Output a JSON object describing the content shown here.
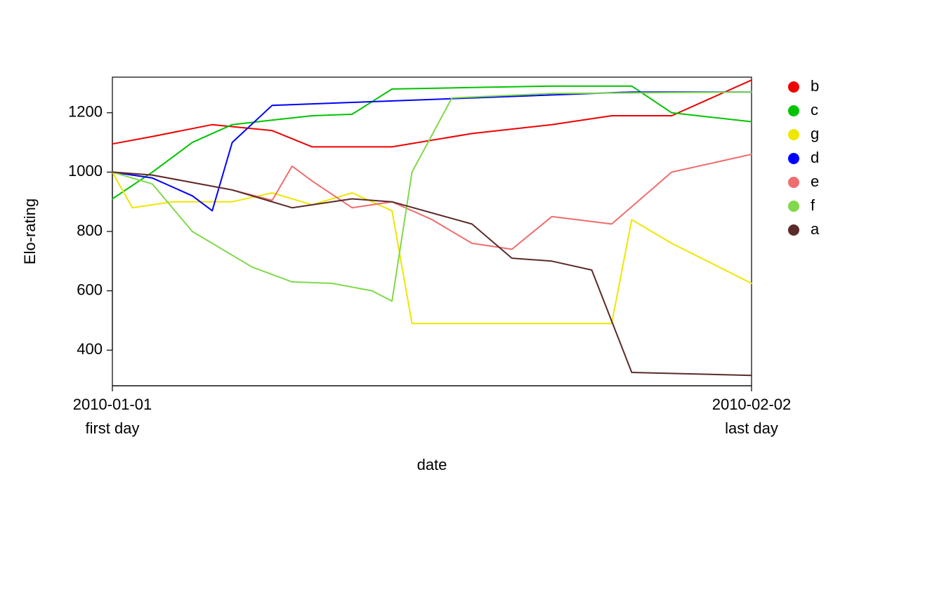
{
  "chart_data": {
    "type": "line",
    "xlabel": "date",
    "ylabel": "Elo-rating",
    "title": "",
    "xlim": [
      0,
      32
    ],
    "ylim": [
      280,
      1320
    ],
    "y_ticks": [
      400,
      600,
      800,
      1000,
      1200
    ],
    "x_tick_labels": [
      "2010-01-01",
      "2010-02-02"
    ],
    "x_tick_positions": [
      0,
      32
    ],
    "x_annotations": [
      "first day",
      "last day"
    ],
    "legend": [
      "b",
      "c",
      "g",
      "d",
      "e",
      "f",
      "a"
    ],
    "colors": {
      "b": "#ef0000",
      "c": "#00c400",
      "g": "#f0e600",
      "d": "#0000ff",
      "e": "#ef6d6d",
      "f": "#7fd94a",
      "a": "#5b2a2a"
    },
    "series": [
      {
        "name": "b",
        "x": [
          0,
          2,
          5,
          8,
          10,
          12,
          14,
          18,
          22,
          25,
          28,
          32
        ],
        "y": [
          1095,
          1120,
          1160,
          1140,
          1085,
          1085,
          1085,
          1130,
          1160,
          1190,
          1190,
          1310
        ]
      },
      {
        "name": "c",
        "x": [
          0,
          2,
          4,
          6,
          8,
          10,
          12,
          14,
          18,
          22,
          26,
          28,
          32
        ],
        "y": [
          910,
          1000,
          1100,
          1160,
          1175,
          1190,
          1195,
          1280,
          1285,
          1290,
          1290,
          1200,
          1170
        ]
      },
      {
        "name": "g",
        "x": [
          0,
          1,
          3,
          6,
          8,
          10,
          12,
          14,
          15,
          22,
          25,
          26,
          28,
          32
        ],
        "y": [
          1000,
          880,
          900,
          900,
          930,
          890,
          930,
          870,
          490,
          490,
          490,
          840,
          760,
          625
        ]
      },
      {
        "name": "d",
        "x": [
          0,
          2,
          4,
          5,
          6,
          8,
          12,
          18,
          26,
          32
        ],
        "y": [
          1000,
          980,
          920,
          870,
          1100,
          1225,
          1235,
          1250,
          1270,
          1270
        ]
      },
      {
        "name": "e",
        "x": [
          0,
          2,
          6,
          8,
          9,
          10,
          12,
          14,
          16,
          18,
          20,
          22,
          25,
          28,
          32
        ],
        "y": [
          1000,
          990,
          940,
          905,
          1020,
          970,
          880,
          900,
          840,
          760,
          740,
          850,
          825,
          1000,
          1060
        ]
      },
      {
        "name": "f",
        "x": [
          0,
          2,
          4,
          7,
          9,
          11,
          13,
          14,
          15,
          17,
          22,
          32
        ],
        "y": [
          1000,
          960,
          800,
          680,
          630,
          625,
          600,
          565,
          1000,
          1250,
          1265,
          1270
        ]
      },
      {
        "name": "a",
        "x": [
          0,
          2,
          6,
          9,
          12,
          14,
          18,
          20,
          22,
          24,
          26,
          32
        ],
        "y": [
          1000,
          990,
          940,
          880,
          910,
          900,
          825,
          710,
          700,
          670,
          325,
          315
        ]
      }
    ]
  }
}
